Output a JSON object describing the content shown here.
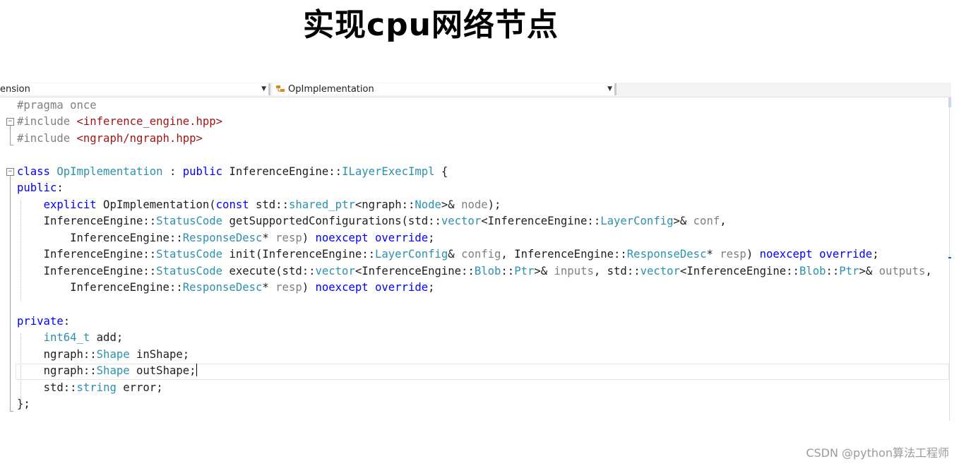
{
  "slide": {
    "title": "实现cpu网络节点"
  },
  "editor": {
    "nav_left_combo": "ension",
    "nav_member_combo": "OpImplementation",
    "colors": {
      "keyword": "#0000ff",
      "type": "#2b91af",
      "preprocessor": "#808080",
      "string": "#a31515",
      "parameter": "#808080",
      "text": "#1e1e1e"
    },
    "code": {
      "l1": {
        "pp": "#pragma once"
      },
      "l2": {
        "pp": "#include ",
        "str": "<inference_engine.hpp>"
      },
      "l3": {
        "pp": "#include ",
        "str": "<ngraph/ngraph.hpp>"
      },
      "l5": {
        "kw_class": "class",
        "sp1": " ",
        "cls": "OpImplementation",
        "colon": " : ",
        "kw_public": "public",
        "base_ns": " InferenceEngine::",
        "base": "ILayerExecImpl",
        "brace": " {"
      },
      "l6": {
        "kw": "public",
        "colon": ":"
      },
      "l7": {
        "indent": "    ",
        "kw_explicit": "explicit",
        "name": " OpImplementation(",
        "kw_const": "const",
        "std": " std::",
        "sp": "shared_ptr",
        "lt": "<ngraph::",
        "node_t": "Node",
        "amp": ">& ",
        "param": "node",
        "end": ");"
      },
      "l8": {
        "indent": "    ",
        "ns": "InferenceEngine::",
        "ty": "StatusCode",
        "fn": " getSupportedConfigurations(std::",
        "vec": "vector",
        "lt": "<InferenceEngine::",
        "lc": "LayerConfig",
        "amp": ">& ",
        "param": "conf",
        "comma": ","
      },
      "l9": {
        "indent": "        ",
        "ns": "InferenceEngine::",
        "ty": "ResponseDesc",
        "star": "* ",
        "param": "resp",
        "close": ") ",
        "kw_noexcept": "noexcept",
        "sp": " ",
        "kw_override": "override",
        "semi": ";"
      },
      "l10": {
        "indent": "    ",
        "ns": "InferenceEngine::",
        "ty": "StatusCode",
        "fn": " init(InferenceEngine::",
        "lc": "LayerConfig",
        "amp": "& ",
        "p1": "config",
        "comma": ", InferenceEngine::",
        "rd": "ResponseDesc",
        "star": "* ",
        "p2": "resp",
        "close": ") ",
        "kw_noexcept": "noexcept",
        "sp": " ",
        "kw_override": "override",
        "semi": ";"
      },
      "l11": {
        "indent": "    ",
        "ns": "InferenceEngine::",
        "ty": "StatusCode",
        "fn": " execute(std::",
        "vec1": "vector",
        "lt1": "<InferenceEngine::",
        "blob1": "Blob",
        "cc1": "::",
        "ptr1": "Ptr",
        "amp1": ">& ",
        "p1": "inputs",
        "comma": ", std::",
        "vec2": "vector",
        "lt2": "<InferenceEngine::",
        "blob2": "Blob",
        "cc2": "::",
        "ptr2": "Ptr",
        "amp2": ">& ",
        "p2": "outputs",
        "tail": ","
      },
      "l12": {
        "indent": "        ",
        "ns": "InferenceEngine::",
        "ty": "ResponseDesc",
        "star": "* ",
        "param": "resp",
        "close": ") ",
        "kw_noexcept": "noexcept",
        "sp": " ",
        "kw_override": "override",
        "semi": ";"
      },
      "l14": {
        "kw": "private",
        "colon": ":"
      },
      "l15": {
        "indent": "    ",
        "ty": "int64_t",
        "rest": " add;"
      },
      "l16": {
        "indent": "    ",
        "ns": "ngraph::",
        "ty": "Shape",
        "rest": " inShape;"
      },
      "l17": {
        "indent": "    ",
        "ns": "ngraph::",
        "ty": "Shape",
        "rest": " outShape;"
      },
      "l18": {
        "indent": "    ",
        "ns": "std::",
        "ty": "string",
        "rest": " error;"
      },
      "l19": {
        "text": "};"
      }
    }
  },
  "watermark": "CSDN @python算法工程师"
}
